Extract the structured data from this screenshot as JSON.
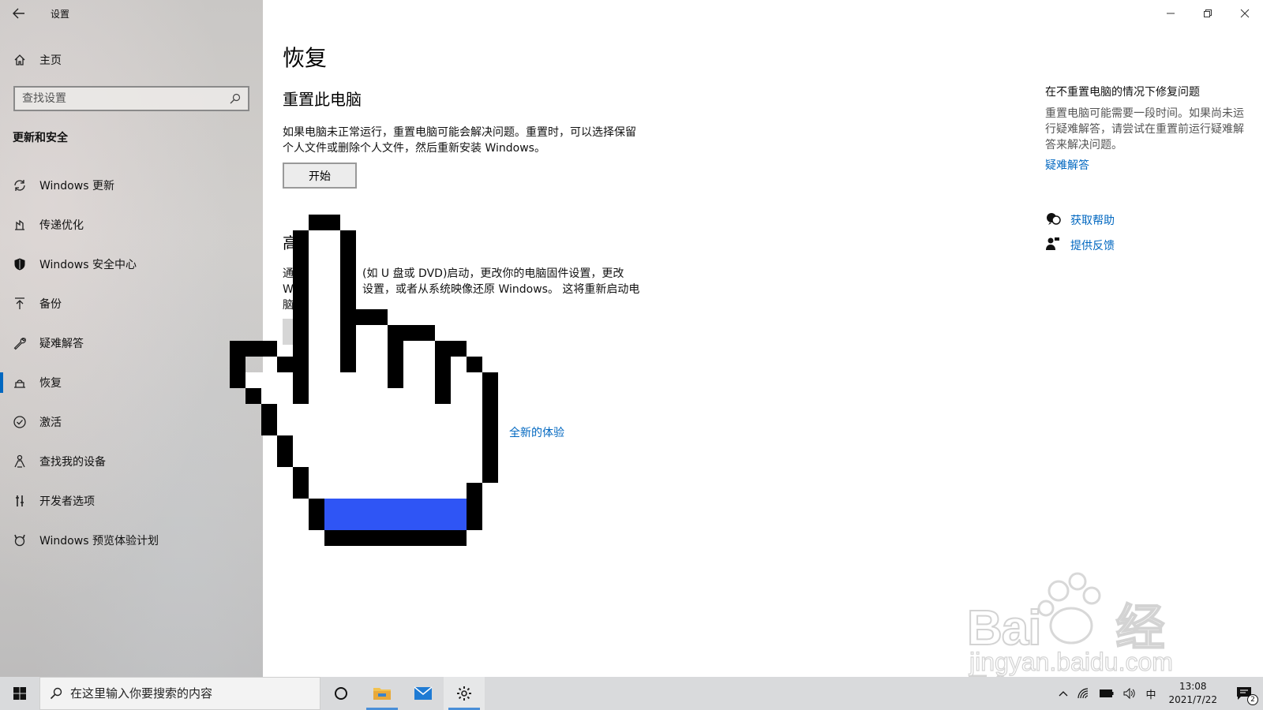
{
  "window": {
    "title": "设置",
    "controls": [
      "minimize",
      "restore",
      "close"
    ]
  },
  "sidebar": {
    "home_label": "主页",
    "search_placeholder": "查找设置",
    "section_title": "更新和安全",
    "items": [
      {
        "label": "Windows 更新",
        "icon": "sync-icon"
      },
      {
        "label": "传递优化",
        "icon": "delivery-icon"
      },
      {
        "label": "Windows 安全中心",
        "icon": "shield-icon"
      },
      {
        "label": "备份",
        "icon": "backup-icon"
      },
      {
        "label": "疑难解答",
        "icon": "wrench-icon"
      },
      {
        "label": "恢复",
        "icon": "recovery-icon",
        "active": true
      },
      {
        "label": "激活",
        "icon": "check-circle-icon"
      },
      {
        "label": "查找我的设备",
        "icon": "person-location-icon"
      },
      {
        "label": "开发者选项",
        "icon": "developer-icon"
      },
      {
        "label": "Windows 预览体验计划",
        "icon": "insider-icon"
      }
    ]
  },
  "main": {
    "title": "恢复",
    "reset": {
      "heading": "重置此电脑",
      "desc_line1": "如果电脑未正常运行，重置电脑可能会解决问题。重置时，可以选择保留",
      "desc_line2": "个人文件或删除个人文件，然后重新安装 Windows。",
      "button": "开始"
    },
    "advanced": {
      "heading_visible": "高",
      "desc_line1_a": "通",
      "desc_line1_b": "(如 U 盘或 DVD)启动，更改你的电脑固件设置，更改",
      "desc_line2_a": "Wi",
      "desc_line2_b": "设置，或者从系统映像还原 Windows。 这将重新启动电",
      "desc_line3": "脑。"
    },
    "fresh_start_link": "全新的体验"
  },
  "right_panel": {
    "title": "在不重置电脑的情况下修复问题",
    "text": "重置电脑可能需要一段时间。如果尚未运行疑难解答，请尝试在重置前运行疑难解答来解决问题。",
    "troubleshoot_link": "疑难解答",
    "get_help": "获取帮助",
    "feedback": "提供反馈"
  },
  "taskbar": {
    "search_placeholder": "在这里输入你要搜索的内容",
    "time": "13:08",
    "date": "2021/7/22",
    "ime": "中",
    "notification_count": "2"
  },
  "watermark": {
    "brand": "Bai",
    "brand_suffix": "经验",
    "url": "jingyan.baidu.com"
  },
  "colors": {
    "accent": "#0067c0",
    "cursor_blue": "#2f55f5",
    "sidebar_bg": "#cdcbc9",
    "taskbar_bg": "#d9dadc"
  }
}
